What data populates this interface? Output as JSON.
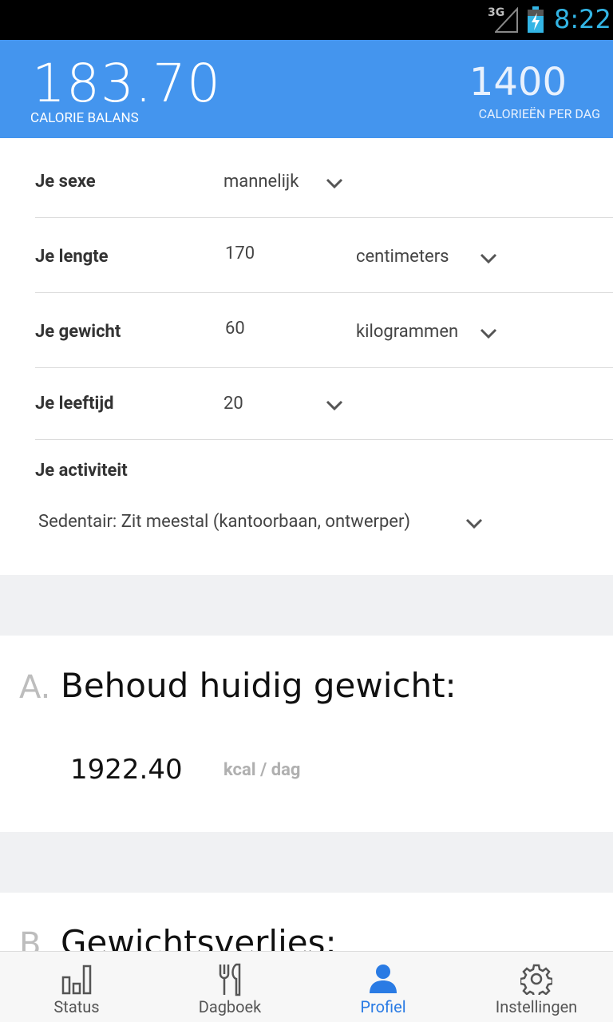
{
  "status_bar": {
    "network": "3G",
    "time": "8:22"
  },
  "header": {
    "balance_value": "183.70",
    "balance_label": "CALORIE BALANS",
    "per_day_value": "1400",
    "per_day_label": "CALORIEËN PER DAG",
    "background_color": "#4495ee"
  },
  "profile_form": {
    "sex": {
      "label": "Je sexe",
      "value": "mannelijk"
    },
    "height": {
      "label": "Je lengte",
      "value": "170",
      "unit": "centimeters"
    },
    "weight": {
      "label": "Je gewicht",
      "value": "60",
      "unit": "kilogrammen"
    },
    "age": {
      "label": "Je leeftijd",
      "value": "20"
    },
    "activity": {
      "label": "Je activiteit",
      "value": "Sedentair: Zit meestal (kantoorbaan, ontwerper)"
    }
  },
  "card_a": {
    "letter": "A.",
    "title": "Behoud huidig gewicht:",
    "value": "1922.40",
    "unit": "kcal / dag"
  },
  "card_b": {
    "letter": "B.",
    "title": "Gewichtsverlies:"
  },
  "bottom_nav": {
    "active_color": "#2a7be4",
    "items": [
      {
        "label": "Status",
        "icon": "bar-chart-icon"
      },
      {
        "label": "Dagboek",
        "icon": "fork-knife-icon"
      },
      {
        "label": "Profiel",
        "icon": "person-icon",
        "active": true
      },
      {
        "label": "Instellingen",
        "icon": "gear-icon"
      }
    ]
  }
}
